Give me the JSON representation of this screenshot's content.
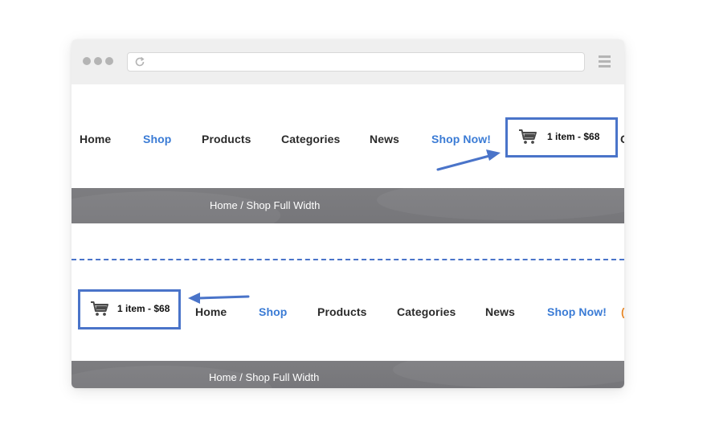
{
  "browser": {
    "icons": {
      "dots": "window-dots-icon",
      "reload": "reload-icon",
      "menu": "hamburger-menu-icon"
    }
  },
  "colors": {
    "accent": "#3a7bd5",
    "highlight_border": "#4a74c9",
    "nav_text": "#2b2b2b",
    "breadcrumb_bg": "#7b7b7e"
  },
  "top_layout": {
    "nav": {
      "home": "Home",
      "shop": "Shop",
      "products": "Products",
      "categories": "Categories",
      "news": "News",
      "shop_now": "Shop Now!"
    },
    "cart": {
      "icon": "cart-icon",
      "label": "1 item - $68"
    },
    "breadcrumb": {
      "home": "Home",
      "separator": " / ",
      "current": "Shop Full Width"
    }
  },
  "bottom_layout": {
    "nav": {
      "home": "Home",
      "shop": "Shop",
      "products": "Products",
      "categories": "Categories",
      "news": "News",
      "shop_now": "Shop Now!"
    },
    "cart": {
      "icon": "cart-icon",
      "label": "1 item - $68"
    },
    "breadcrumb": {
      "home": "Home",
      "separator": " / ",
      "current": "Shop Full Width"
    }
  }
}
